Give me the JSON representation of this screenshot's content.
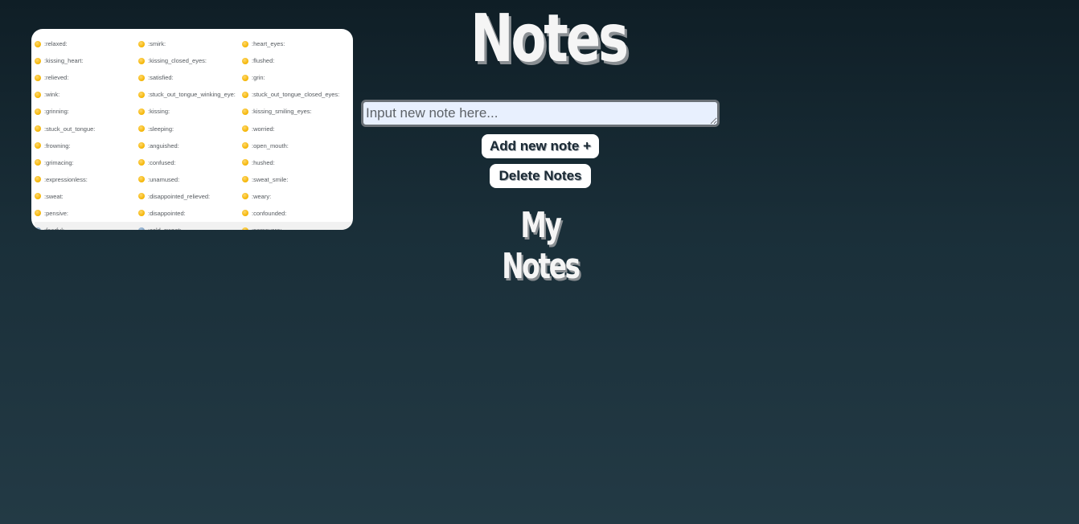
{
  "header": {
    "title": "Notes"
  },
  "note_input": {
    "placeholder": "Input new note here...",
    "value": ""
  },
  "buttons": {
    "add_label": "Add new note +",
    "delete_label": "Delete Notes"
  },
  "notes_section": {
    "heading": "My Notes"
  },
  "emoji_reference": {
    "rows": [
      [
        ":relaxed:",
        ":smirk:",
        ":heart_eyes:"
      ],
      [
        ":kissing_heart:",
        ":kissing_closed_eyes:",
        ":flushed:"
      ],
      [
        ":relieved:",
        ":satisfied:",
        ":grin:"
      ],
      [
        ":wink:",
        ":stuck_out_tongue_winking_eye:",
        ":stuck_out_tongue_closed_eyes:"
      ],
      [
        ":grinning:",
        ":kissing:",
        ":kissing_smiling_eyes:"
      ],
      [
        ":stuck_out_tongue:",
        ":sleeping:",
        ":worried:"
      ],
      [
        ":frowning:",
        ":anguished:",
        ":open_mouth:"
      ],
      [
        ":grimacing:",
        ":confused:",
        ":hushed:"
      ],
      [
        ":expressionless:",
        ":unamused:",
        ":sweat_smile:"
      ],
      [
        ":sweat:",
        ":disappointed_relieved:",
        ":weary:"
      ],
      [
        ":pensive:",
        ":disappointed:",
        ":confounded:"
      ],
      [
        ":fearful:",
        ":cold_sweat:",
        ":persevere:"
      ]
    ]
  },
  "colors": {
    "background_top": "#0f1e26",
    "background_bottom": "#233a45",
    "button_text": "#1b2a35",
    "input_background": "#e8f0fe"
  }
}
